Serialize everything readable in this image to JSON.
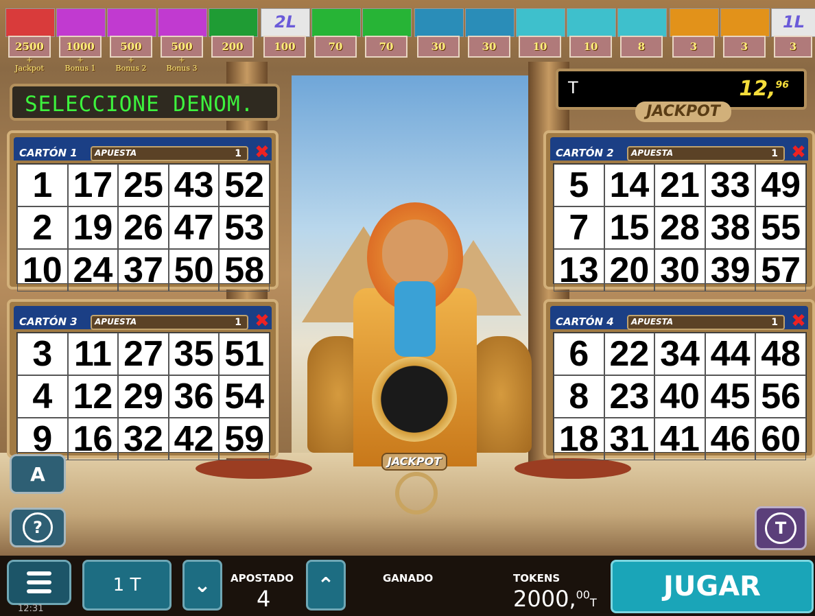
{
  "paytable": [
    {
      "value": "2500",
      "bonus": [
        "+",
        "Jackpot"
      ],
      "color": "#d93b3b"
    },
    {
      "value": "1000",
      "bonus": [
        "+",
        "Bonus 1"
      ],
      "color": "#c13ad0"
    },
    {
      "value": "500",
      "bonus": [
        "+",
        "Bonus 2"
      ],
      "color": "#c13ad0"
    },
    {
      "value": "500",
      "bonus": [
        "+",
        "Bonus 3"
      ],
      "color": "#c13ad0"
    },
    {
      "value": "200",
      "bonus": [],
      "color": "#1f9c34"
    },
    {
      "value": "100",
      "bonus": [],
      "color": "#6a5ad9",
      "mark": "2L"
    },
    {
      "value": "70",
      "bonus": [],
      "color": "#27b436"
    },
    {
      "value": "70",
      "bonus": [],
      "color": "#27b436"
    },
    {
      "value": "30",
      "bonus": [],
      "color": "#2a8db8"
    },
    {
      "value": "30",
      "bonus": [],
      "color": "#2a8db8"
    },
    {
      "value": "10",
      "bonus": [],
      "color": "#3ec0cc"
    },
    {
      "value": "10",
      "bonus": [],
      "color": "#3ec0cc"
    },
    {
      "value": "8",
      "bonus": [],
      "color": "#3ec0cc"
    },
    {
      "value": "3",
      "bonus": [],
      "color": "#e2921a"
    },
    {
      "value": "3",
      "bonus": [],
      "color": "#e2921a"
    },
    {
      "value": "3",
      "bonus": [],
      "color": "#6a5ad9",
      "mark": "1L"
    }
  ],
  "display": {
    "message": "SELECCIONE DENOM."
  },
  "jackpot": {
    "currency": "T",
    "amount": "12,",
    "cents": "96",
    "label": "JACKPOT"
  },
  "cards": [
    {
      "name": "CARTÓN 1",
      "bet_label": "APUESTA",
      "bet": "1",
      "numbers": [
        "1",
        "17",
        "25",
        "43",
        "52",
        "2",
        "19",
        "26",
        "47",
        "53",
        "10",
        "24",
        "37",
        "50",
        "58"
      ]
    },
    {
      "name": "CARTÓN 2",
      "bet_label": "APUESTA",
      "bet": "1",
      "numbers": [
        "5",
        "14",
        "21",
        "33",
        "49",
        "7",
        "15",
        "28",
        "38",
        "55",
        "13",
        "20",
        "30",
        "39",
        "57"
      ]
    },
    {
      "name": "CARTÓN 3",
      "bet_label": "APUESTA",
      "bet": "1",
      "numbers": [
        "3",
        "11",
        "27",
        "35",
        "51",
        "4",
        "12",
        "29",
        "36",
        "54",
        "9",
        "16",
        "32",
        "42",
        "59"
      ]
    },
    {
      "name": "CARTÓN 4",
      "bet_label": "APUESTA",
      "bet": "1",
      "numbers": [
        "6",
        "22",
        "34",
        "44",
        "48",
        "8",
        "23",
        "40",
        "45",
        "56",
        "18",
        "31",
        "41",
        "46",
        "60"
      ]
    }
  ],
  "ring_label": "JACKPOT",
  "buttons": {
    "auto": "A",
    "help": "?",
    "tokens": "T"
  },
  "bottom": {
    "time": "12:31",
    "denomination": "1 T",
    "bet_label": "APOSTADO",
    "bet_value": "4",
    "won_label": "GANADO",
    "tokens_label": "TOKENS",
    "tokens_value": "2000,",
    "tokens_cents": "00",
    "tokens_unit": "T",
    "play": "JUGAR"
  }
}
